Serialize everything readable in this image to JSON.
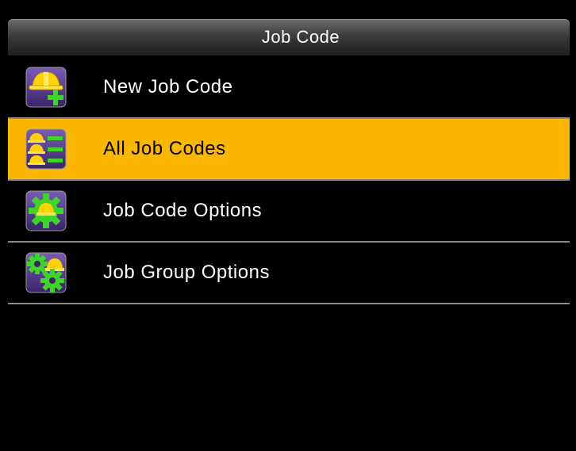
{
  "header": {
    "title": "Job Code"
  },
  "menu": {
    "items": [
      {
        "label": "New Job Code",
        "icon": "new-job-code-icon",
        "selected": false
      },
      {
        "label": "All Job Codes",
        "icon": "all-job-codes-icon",
        "selected": true
      },
      {
        "label": "Job Code Options",
        "icon": "job-code-options-icon",
        "selected": false
      },
      {
        "label": "Job Group Options",
        "icon": "job-group-options-icon",
        "selected": false
      }
    ]
  },
  "colors": {
    "selected_background": "#fbb700",
    "background": "#000000",
    "divider": "#8a8a8a",
    "icon_purple": "#5a3d8c",
    "icon_yellow": "#ffd200",
    "icon_green": "#3ed42a"
  }
}
